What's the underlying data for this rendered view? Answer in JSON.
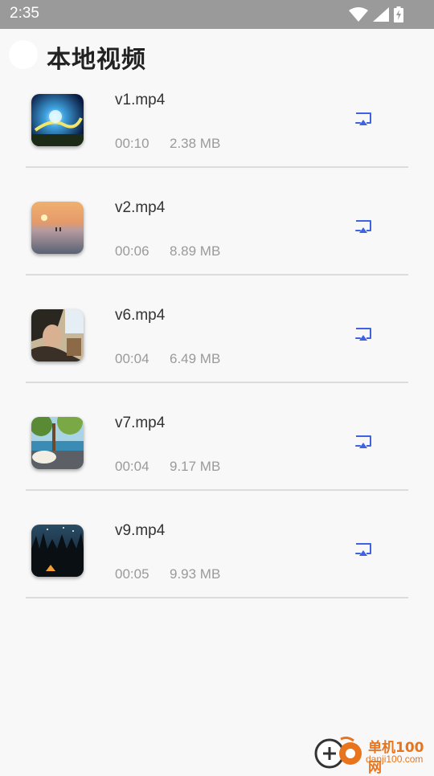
{
  "status_bar": {
    "time": "2:35",
    "icons": [
      "wifi-icon",
      "cellular-signal-icon",
      "battery-charging-icon"
    ]
  },
  "header": {
    "title": "本地视频"
  },
  "colors": {
    "accent": "#3f63e0",
    "status_bar": "#9a9a9a",
    "background": "#f8f8f8",
    "watermark": "#e8741e"
  },
  "videos": [
    {
      "name": "v1.mp4",
      "duration": "00:10",
      "size": "2.38 MB",
      "action_icon": "cast-icon"
    },
    {
      "name": "v2.mp4",
      "duration": "00:06",
      "size": "8.89 MB",
      "action_icon": "cast-icon"
    },
    {
      "name": "v6.mp4",
      "duration": "00:04",
      "size": "6.49 MB",
      "action_icon": "cast-icon"
    },
    {
      "name": "v7.mp4",
      "duration": "00:04",
      "size": "9.17 MB",
      "action_icon": "cast-icon"
    },
    {
      "name": "v9.mp4",
      "duration": "00:05",
      "size": "9.93 MB",
      "action_icon": "cast-icon"
    }
  ],
  "watermark": {
    "title": "单机100网",
    "url": "danji100.com"
  }
}
